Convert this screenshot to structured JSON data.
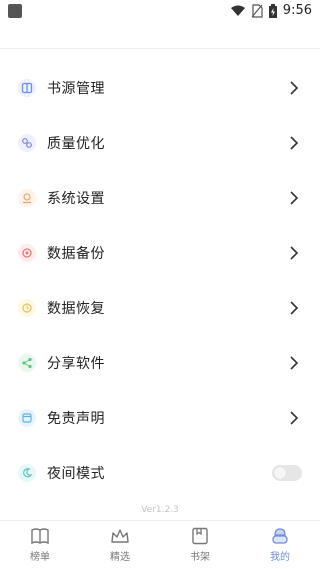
{
  "status_bar": {
    "time": "9:56",
    "icons": [
      "app-notification-icon",
      "wifi-icon",
      "no-sim-icon",
      "battery-charging-icon"
    ]
  },
  "menu": {
    "items": [
      {
        "label": "书源管理",
        "icon": "book-source-icon",
        "color": "#6c8df0"
      },
      {
        "label": "质量优化",
        "icon": "quality-icon",
        "color": "#7f86d9"
      },
      {
        "label": "系统设置",
        "icon": "settings-icon",
        "color": "#f0a36e"
      },
      {
        "label": "数据备份",
        "icon": "backup-icon",
        "color": "#e97878"
      },
      {
        "label": "数据恢复",
        "icon": "restore-icon",
        "color": "#e8c35a"
      },
      {
        "label": "分享软件",
        "icon": "share-icon",
        "color": "#62c27a"
      },
      {
        "label": "免责声明",
        "icon": "disclaimer-icon",
        "color": "#5fb2e6"
      },
      {
        "label": "夜间模式",
        "icon": "night-mode-icon",
        "color": "#5fc1c2"
      }
    ],
    "night_mode_enabled": false
  },
  "version": "Ver1.2.3",
  "bottom_nav": {
    "items": [
      {
        "label": "榜单",
        "icon": "ranking-book-icon",
        "active": false
      },
      {
        "label": "精选",
        "icon": "crown-icon",
        "active": false
      },
      {
        "label": "书架",
        "icon": "bookshelf-icon",
        "active": false
      },
      {
        "label": "我的",
        "icon": "profile-icon",
        "active": true
      }
    ]
  },
  "colors": {
    "accent": "#6f8fd8",
    "text": "#222222",
    "muted": "#777777"
  }
}
